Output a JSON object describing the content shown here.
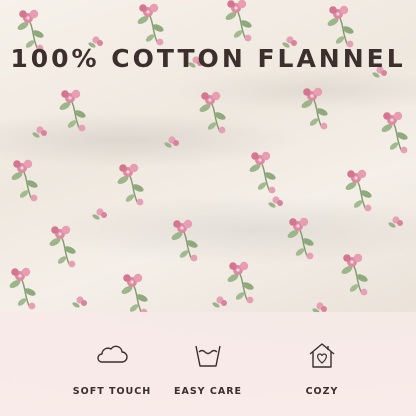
{
  "headline": "100% COTTON FLANNEL",
  "features": [
    {
      "label": "SOFT TOUCH",
      "icon": "cloud-icon"
    },
    {
      "label": "EASY CARE",
      "icon": "wash-tub-icon"
    },
    {
      "label": "COZY",
      "icon": "house-heart-icon"
    }
  ],
  "colors": {
    "headline_text": "#3d2f2c",
    "feature_panel": "#f7eae8",
    "flower_pink": "#d97d98",
    "leaf_green": "#8fa87c"
  }
}
